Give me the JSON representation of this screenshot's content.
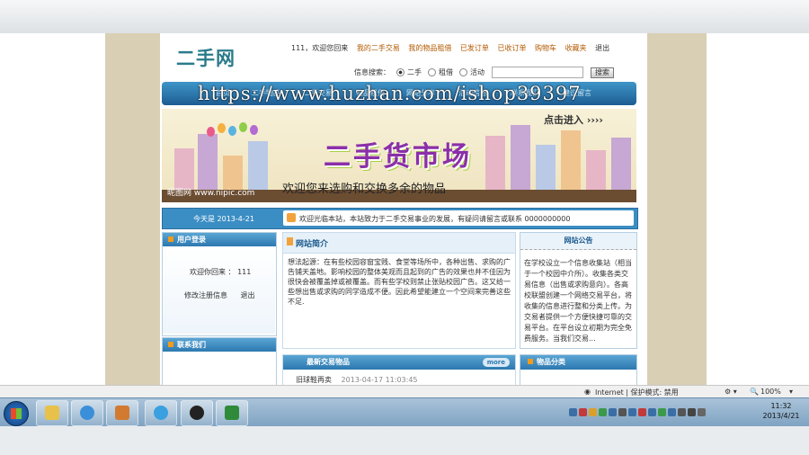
{
  "header": {
    "logo": "二手网",
    "greeting": "111，欢迎您回来",
    "links": [
      "我的二手交易",
      "我的物品租借",
      "已发订单",
      "已收订单",
      "购物车",
      "收藏夹",
      "退出"
    ]
  },
  "search": {
    "label": "信息搜索：",
    "options": [
      "二手",
      "租借",
      "活动"
    ],
    "selected": "二手",
    "button": "搜索"
  },
  "nav": {
    "items": [
      "首页",
      "二手物品",
      "二手交易",
      "物品租借",
      "网站分享",
      "活动信息",
      "联系我们",
      "建议留言"
    ]
  },
  "banner": {
    "title": "二手货市场",
    "enter": "点击进入",
    "slogan": "欢迎您来选购和交换多余的物品",
    "site": "昵图网 www.nipic.com"
  },
  "datebar": {
    "date": "今天是  2013-4-21",
    "ticker": "欢迎光临本站，本站致力于二手交易事业的发展，有疑问请留言或联系  0000000000"
  },
  "login": {
    "title": "用户登录",
    "welcome": "欢迎你回来 ：  111",
    "edit": "修改注册信息",
    "logout": "退出"
  },
  "contact": {
    "title": "联系我们"
  },
  "intro": {
    "title": "网站简介",
    "text": "想法起源：在有些校园容窗宝贱、食堂等场所中，各种出售、求购的广告铺天盖地。影响校园的整体美观而且起到的广告的效果也并不佳因为很快会被覆盖掉或被覆盖。而有些学校则禁止张贴校园广告。这又给一些想出售或求购的同学造成不便。因此希望能建立一个空间来完善这些不足."
  },
  "notice": {
    "title": "网站公告",
    "text": "在学校设立一个信息收集站（相当于一个校园中介所）。收集各类交易信息（出售或求购意向）。各高校联盟创建一个网络交易平台，将收集的信息进行整和分类上传。为交易者提供一个方便快捷可靠的交易平台。在平台设立初期为完全免费服务。当我们交易..."
  },
  "newest": {
    "title": "最新交易物品",
    "more": "more",
    "first_item": "旧球鞋再卖",
    "first_date": "2013-04-17 11:03:45"
  },
  "category": {
    "title": "物品分类"
  },
  "watermark": "https://www.huzhan.com/ishop39397",
  "statusbar": {
    "zone": "Internet | 保护模式: 禁用",
    "zoom": "100%"
  },
  "clock": {
    "time": "11:32",
    "date": "2013/4/21"
  }
}
